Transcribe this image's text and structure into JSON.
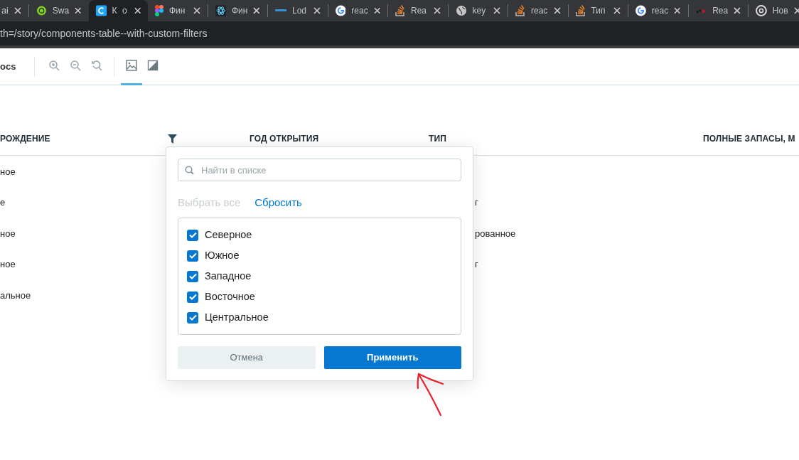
{
  "browser_tabs": [
    {
      "title": "ai",
      "kind": "none",
      "selected": false
    },
    {
      "title": "Swa",
      "kind": "globe-green",
      "selected": false
    },
    {
      "title": "К о",
      "kind": "letter-c",
      "selected": true
    },
    {
      "title": "Фин",
      "kind": "figma",
      "selected": false
    },
    {
      "title": "Фин",
      "kind": "atom",
      "selected": false
    },
    {
      "title": "Lod",
      "kind": "underscore",
      "selected": false
    },
    {
      "title": "reac",
      "kind": "google",
      "selected": false
    },
    {
      "title": "Rea",
      "kind": "stack",
      "selected": false
    },
    {
      "title": "key",
      "kind": "globe",
      "selected": false
    },
    {
      "title": "reac",
      "kind": "stack",
      "selected": false
    },
    {
      "title": "Тип",
      "kind": "stack",
      "selected": false
    },
    {
      "title": "reac",
      "kind": "google",
      "selected": false
    },
    {
      "title": "Rea",
      "kind": "dots",
      "selected": false
    },
    {
      "title": "Нов",
      "kind": "chrome",
      "selected": false
    }
  ],
  "address_bar": {
    "url": "th=/story/components-table--with-custom-filters"
  },
  "toolbar": {
    "docs_tab": "ocs",
    "tools": [
      {
        "kind": "zoom-in",
        "selected": false
      },
      {
        "kind": "zoom-out",
        "selected": false
      },
      {
        "kind": "reset",
        "selected": false
      },
      {
        "kind": "image",
        "selected": true
      },
      {
        "kind": "contrast",
        "selected": false
      }
    ]
  },
  "table": {
    "columns": [
      {
        "label": "РОЖДЕНИЕ",
        "filter": true
      },
      {
        "label": "ГОД ОТКРЫТИЯ",
        "filter": false
      },
      {
        "label": "ТИП",
        "filter": false
      },
      {
        "label": "ПОЛНЫЕ ЗАПАСЫ, М",
        "filter": false
      }
    ],
    "rows": [
      [
        "ное",
        "",
        ""
      ],
      [
        "е",
        "",
        "г"
      ],
      [
        "ное",
        "",
        "рованное"
      ],
      [
        "ное",
        "",
        "г"
      ],
      [
        "альное",
        "",
        ""
      ]
    ]
  },
  "filter_popup": {
    "search_placeholder": "Найти в списке",
    "select_all": "Выбрать все",
    "select_all_disabled": true,
    "reset": "Сбросить",
    "options": [
      {
        "label": "Северное",
        "checked": true
      },
      {
        "label": "Южное",
        "checked": true
      },
      {
        "label": "Западное",
        "checked": true
      },
      {
        "label": "Восточное",
        "checked": true
      },
      {
        "label": "Центральное",
        "checked": true
      }
    ],
    "cancel": "Отмена",
    "apply": "Применить"
  },
  "annotation": {
    "kind": "arrow"
  }
}
